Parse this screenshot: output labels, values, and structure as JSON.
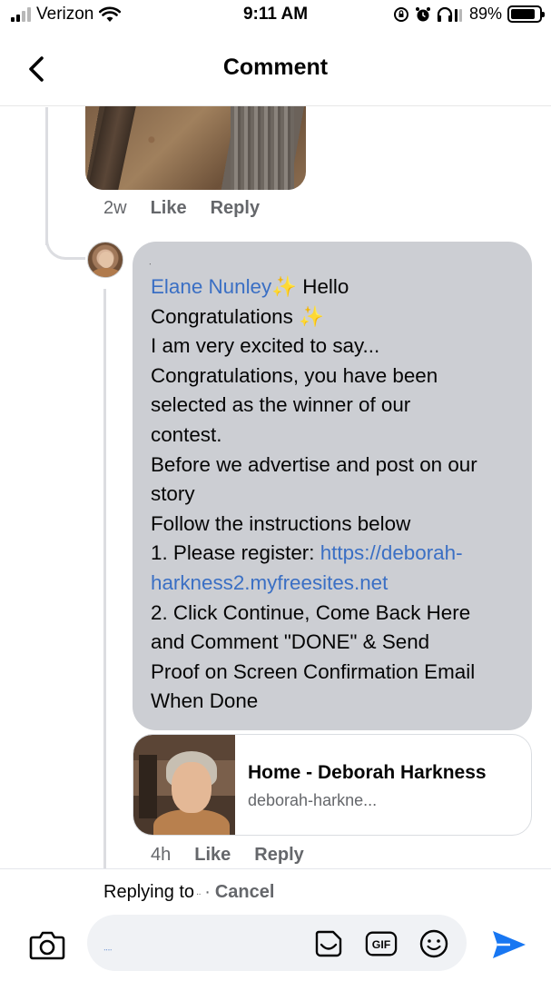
{
  "status_bar": {
    "carrier": "Verizon",
    "time": "9:11 AM",
    "battery": "89%"
  },
  "header": {
    "title": "Comment"
  },
  "previous_comment": {
    "time": "2w",
    "like_label": "Like",
    "reply_label": "Reply"
  },
  "comment": {
    "author_tiny": "ᐧ",
    "mention": "Elane Nunley",
    "sparkle": "✨",
    "text_after_mention": " Hello\nCongratulations ",
    "text_body": "\nI am very excited to say...\nCongratulations, you have been\nselected as the winner of our\ncontest.\nBefore we advertise and post on our\nstory\nFollow the instructions below\n1. Please register: ",
    "link": "https://deborah-\nharkness2.myfreesites.net",
    "text_end": "\n2. Click Continue, Come Back Here\nand Comment \"DONE\" & Send\nProof on Screen Confirmation Email\nWhen Done",
    "time": "4h",
    "like_label": "Like",
    "reply_label": "Reply"
  },
  "link_preview": {
    "title": "Home - Deborah Harkness",
    "domain": "deborah-harkne..."
  },
  "reply_bar": {
    "replying_to": "Replying to",
    "replying_name_tiny": "ᐧᐧ",
    "separator": "·",
    "cancel": "Cancel",
    "input_value": "ᐧᐧᐧᐧ",
    "gif_label": "GIF"
  },
  "icons": {
    "back": "chevron-left-icon",
    "camera": "camera-icon",
    "sticker": "sticker-icon",
    "gif": "gif-icon",
    "emoji": "emoji-icon",
    "send": "send-icon",
    "wifi": "wifi-icon",
    "alarm": "alarm-icon",
    "headphones": "headphones-icon",
    "lock_rotation": "orientation-lock-icon"
  },
  "colors": {
    "accent_blue": "#1877f2",
    "link_blue": "#3a6fc4",
    "bubble_gray": "#ccced3",
    "meta_gray": "#65676b"
  }
}
